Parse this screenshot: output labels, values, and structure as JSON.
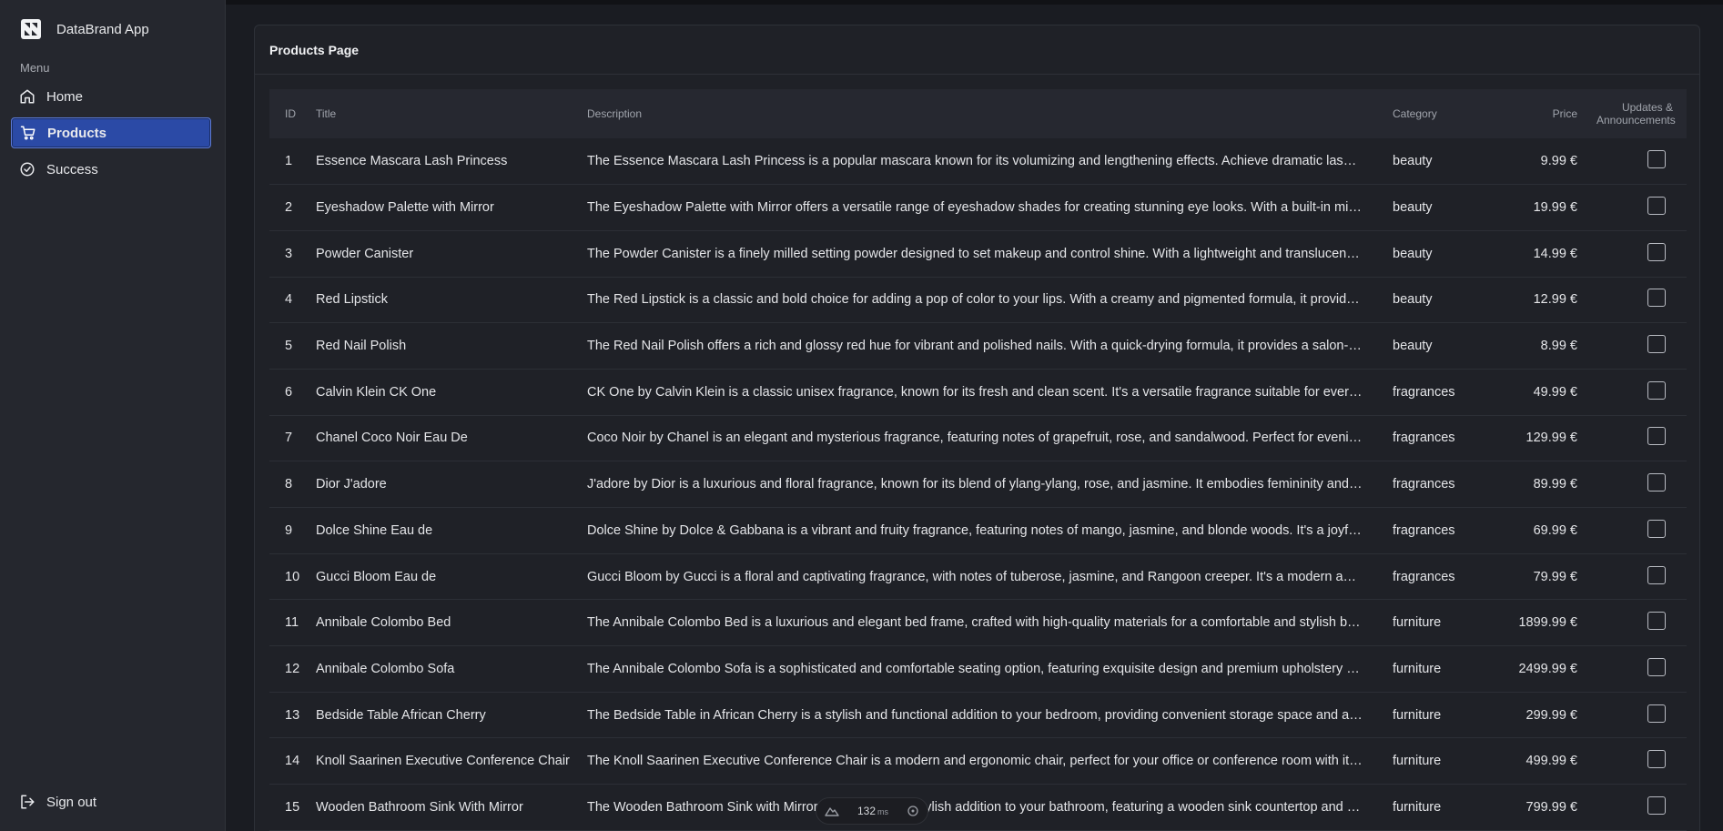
{
  "app": {
    "name": "DataBrand App"
  },
  "sidebar": {
    "menu_label": "Menu",
    "items": [
      {
        "label": "Home",
        "icon": "home-icon"
      },
      {
        "label": "Products",
        "icon": "cart-icon",
        "active": true
      },
      {
        "label": "Success",
        "icon": "check-circle-icon"
      }
    ],
    "signout": {
      "label": "Sign out",
      "icon": "logout-icon"
    }
  },
  "page": {
    "title": "Products Page"
  },
  "table": {
    "headers": {
      "id": "ID",
      "title": "Title",
      "description": "Description",
      "category": "Category",
      "price": "Price",
      "updates": "Updates & Announcements"
    },
    "rows": [
      {
        "id": "1",
        "title": "Essence Mascara Lash Princess",
        "description": "The Essence Mascara Lash Princess is a popular mascara known for its volumizing and lengthening effects. Achieve dramatic lashes with this long-lasting and cruelty-free formula.",
        "category": "beauty",
        "price": "9.99 €"
      },
      {
        "id": "2",
        "title": "Eyeshadow Palette with Mirror",
        "description": "The Eyeshadow Palette with Mirror offers a versatile range of eyeshadow shades for creating stunning eye looks. With a built-in mirror, it's convenient for on-the-go makeup application.",
        "category": "beauty",
        "price": "19.99 €"
      },
      {
        "id": "3",
        "title": "Powder Canister",
        "description": "The Powder Canister is a finely milled setting powder designed to set makeup and control shine. With a lightweight and translucent formula, it provides a smooth and matte finish.",
        "category": "beauty",
        "price": "14.99 €"
      },
      {
        "id": "4",
        "title": "Red Lipstick",
        "description": "The Red Lipstick is a classic and bold choice for adding a pop of color to your lips. With a creamy and pigmented formula, it provides a vibrant and long-lasting finish.",
        "category": "beauty",
        "price": "12.99 €"
      },
      {
        "id": "5",
        "title": "Red Nail Polish",
        "description": "The Red Nail Polish offers a rich and glossy red hue for vibrant and polished nails. With a quick-drying formula, it provides a salon-quality finish at home.",
        "category": "beauty",
        "price": "8.99 €"
      },
      {
        "id": "6",
        "title": "Calvin Klein CK One",
        "description": "CK One by Calvin Klein is a classic unisex fragrance, known for its fresh and clean scent. It's a versatile fragrance suitable for everyday wear.",
        "category": "fragrances",
        "price": "49.99 €"
      },
      {
        "id": "7",
        "title": "Chanel Coco Noir Eau De",
        "description": "Coco Noir by Chanel is an elegant and mysterious fragrance, featuring notes of grapefruit, rose, and sandalwood. Perfect for evening occasions.",
        "category": "fragrances",
        "price": "129.99 €"
      },
      {
        "id": "8",
        "title": "Dior J'adore",
        "description": "J'adore by Dior is a luxurious and floral fragrance, known for its blend of ylang-ylang, rose, and jasmine. It embodies femininity and sophistication.",
        "category": "fragrances",
        "price": "89.99 €"
      },
      {
        "id": "9",
        "title": "Dolce Shine Eau de",
        "description": "Dolce Shine by Dolce & Gabbana is a vibrant and fruity fragrance, featuring notes of mango, jasmine, and blonde woods. It's a joyful and youthful scent.",
        "category": "fragrances",
        "price": "69.99 €"
      },
      {
        "id": "10",
        "title": "Gucci Bloom Eau de",
        "description": "Gucci Bloom by Gucci is a floral and captivating fragrance, with notes of tuberose, jasmine, and Rangoon creeper. It's a modern and romantic scent.",
        "category": "fragrances",
        "price": "79.99 €"
      },
      {
        "id": "11",
        "title": "Annibale Colombo Bed",
        "description": "The Annibale Colombo Bed is a luxurious and elegant bed frame, crafted with high-quality materials for a comfortable and stylish bedroom.",
        "category": "furniture",
        "price": "1899.99 €"
      },
      {
        "id": "12",
        "title": "Annibale Colombo Sofa",
        "description": "The Annibale Colombo Sofa is a sophisticated and comfortable seating option, featuring exquisite design and premium upholstery for your living room.",
        "category": "furniture",
        "price": "2499.99 €"
      },
      {
        "id": "13",
        "title": "Bedside Table African Cherry",
        "description": "The Bedside Table in African Cherry is a stylish and functional addition to your bedroom, providing convenient storage space and a touch of elegance.",
        "category": "furniture",
        "price": "299.99 €"
      },
      {
        "id": "14",
        "title": "Knoll Saarinen Executive Conference Chair",
        "description": "The Knoll Saarinen Executive Conference Chair is a modern and ergonomic chair, perfect for your office or conference room with its timeless design.",
        "category": "furniture",
        "price": "499.99 €"
      },
      {
        "id": "15",
        "title": "Wooden Bathroom Sink With Mirror",
        "description": "The Wooden Bathroom Sink with Mirror is a unique and stylish addition to your bathroom, featuring a wooden sink countertop and a matching mirror.",
        "category": "furniture",
        "price": "799.99 €"
      }
    ]
  },
  "perf_badge": {
    "value": "132",
    "unit": "ms"
  },
  "colors": {
    "accent": "#2b4aa6",
    "sidebar_bg": "#25272e",
    "content_bg": "#1a1c22"
  }
}
